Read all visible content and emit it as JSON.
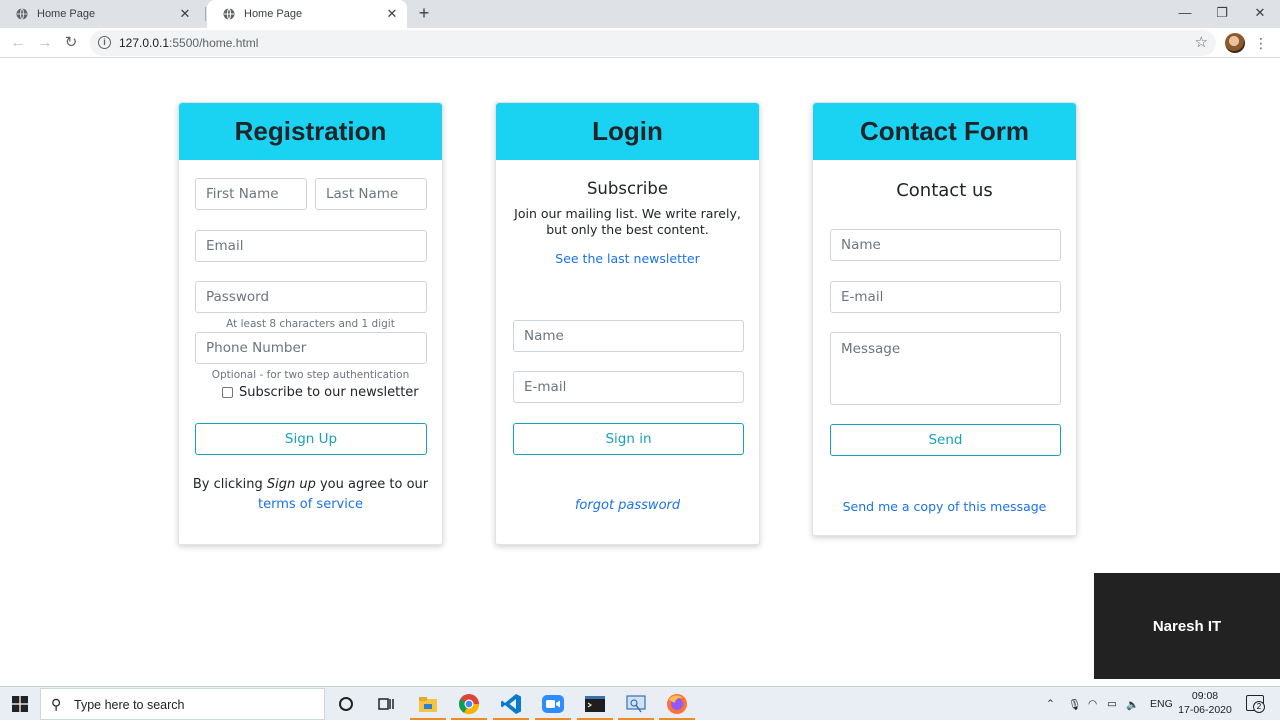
{
  "browser": {
    "tabs": [
      {
        "title": "Home Page",
        "active": false
      },
      {
        "title": "Home Page",
        "active": true
      }
    ],
    "url_host": "127.0.0.1",
    "url_path": ":5500/home.html"
  },
  "registration": {
    "title": "Registration",
    "first_name_placeholder": "First Name",
    "last_name_placeholder": "Last Name",
    "email_placeholder": "Email",
    "password_placeholder": "Password",
    "password_hint": "At least 8 characters and 1 digit",
    "phone_placeholder": "Phone Number",
    "phone_hint": "Optional - for two step authentication",
    "newsletter_label": "Subscribe to our newsletter",
    "signup_button": "Sign Up",
    "agree_prefix": "By clicking ",
    "agree_em": "Sign up",
    "agree_suffix": " you agree to our",
    "terms_link": "terms of service"
  },
  "login": {
    "title": "Login",
    "subscribe_heading": "Subscribe",
    "subscribe_text_line1": "Join our mailing list. We write rarely,",
    "subscribe_text_line2": "but only the best content.",
    "newsletter_link": "See the last newsletter",
    "name_placeholder": "Name",
    "email_placeholder": "E-mail",
    "signin_button": "Sign in",
    "forgot_link": "forgot password"
  },
  "contact": {
    "title": "Contact Form",
    "heading": "Contact us",
    "name_placeholder": "Name",
    "email_placeholder": "E-mail",
    "message_placeholder": "Message",
    "send_button": "Send",
    "copy_link": "Send me a copy of this message"
  },
  "overlay": {
    "label": "Naresh IT"
  },
  "taskbar": {
    "search_placeholder": "Type here to search",
    "language": "ENG",
    "time": "09:08",
    "date": "17-06-2020",
    "notification_count": "2"
  },
  "colors": {
    "header_bg": "#1ad3f2",
    "accent_outline": "#17a2b8",
    "link": "#1a73e8"
  }
}
